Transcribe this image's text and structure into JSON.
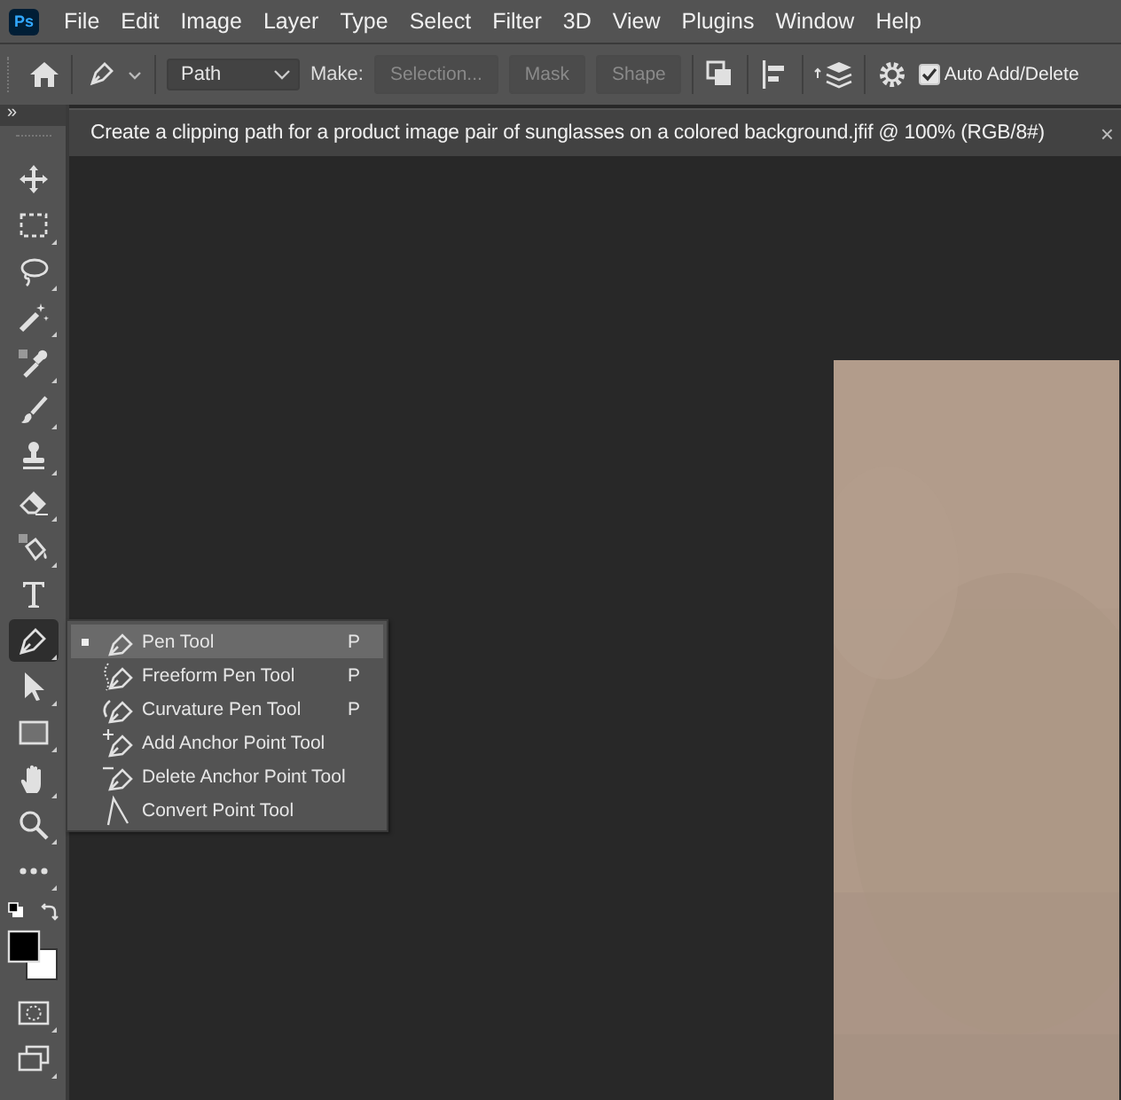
{
  "app_logo": "Ps",
  "menu": [
    "File",
    "Edit",
    "Image",
    "Layer",
    "Type",
    "Select",
    "Filter",
    "3D",
    "View",
    "Plugins",
    "Window",
    "Help"
  ],
  "options_bar": {
    "mode": "Path",
    "make_label": "Make:",
    "make_buttons": [
      {
        "label": "Selection...",
        "disabled": true
      },
      {
        "label": "Mask",
        "disabled": true
      },
      {
        "label": "Shape",
        "disabled": true
      }
    ],
    "auto_add_delete": {
      "label": "Auto Add/Delete",
      "checked": true
    }
  },
  "document_tab": {
    "title": "Create a clipping path for a product image pair of sunglasses on a colored background.jfif @ 100% (RGB/8#)",
    "close": "×"
  },
  "toolbar": {
    "collapse": "»",
    "tools": [
      {
        "kind": "move",
        "selected": false
      },
      {
        "kind": "marquee",
        "selected": false
      },
      {
        "kind": "lasso",
        "selected": false
      },
      {
        "kind": "wand",
        "selected": false
      },
      {
        "kind": "eyedropper",
        "selected": false
      },
      {
        "kind": "brush",
        "selected": false
      },
      {
        "kind": "stamp",
        "selected": false
      },
      {
        "kind": "eraser",
        "selected": false
      },
      {
        "kind": "bucket",
        "selected": false
      },
      {
        "kind": "type",
        "selected": false
      },
      {
        "kind": "pen",
        "selected": true
      },
      {
        "kind": "arrow",
        "selected": false
      },
      {
        "kind": "rectangle",
        "selected": false
      },
      {
        "kind": "hand",
        "selected": false
      },
      {
        "kind": "zoom",
        "selected": false
      },
      {
        "kind": "more",
        "selected": false
      },
      {
        "kind": "swap",
        "selected": false
      },
      {
        "kind": "colors",
        "selected": false
      },
      {
        "kind": "quickmask",
        "selected": false
      },
      {
        "kind": "screenmode",
        "selected": false
      }
    ]
  },
  "flyout": [
    {
      "kind": "pen",
      "label": "Pen Tool",
      "shortcut": "P",
      "selected": true
    },
    {
      "kind": "freeform",
      "label": "Freeform Pen Tool",
      "shortcut": "P",
      "selected": false
    },
    {
      "kind": "curvature",
      "label": "Curvature Pen Tool",
      "shortcut": "P",
      "selected": false
    },
    {
      "kind": "add",
      "label": "Add Anchor Point Tool",
      "selected": false
    },
    {
      "kind": "delete",
      "label": "Delete Anchor Point Tool",
      "selected": false
    },
    {
      "kind": "convert",
      "label": "Convert Point Tool",
      "selected": false
    }
  ]
}
